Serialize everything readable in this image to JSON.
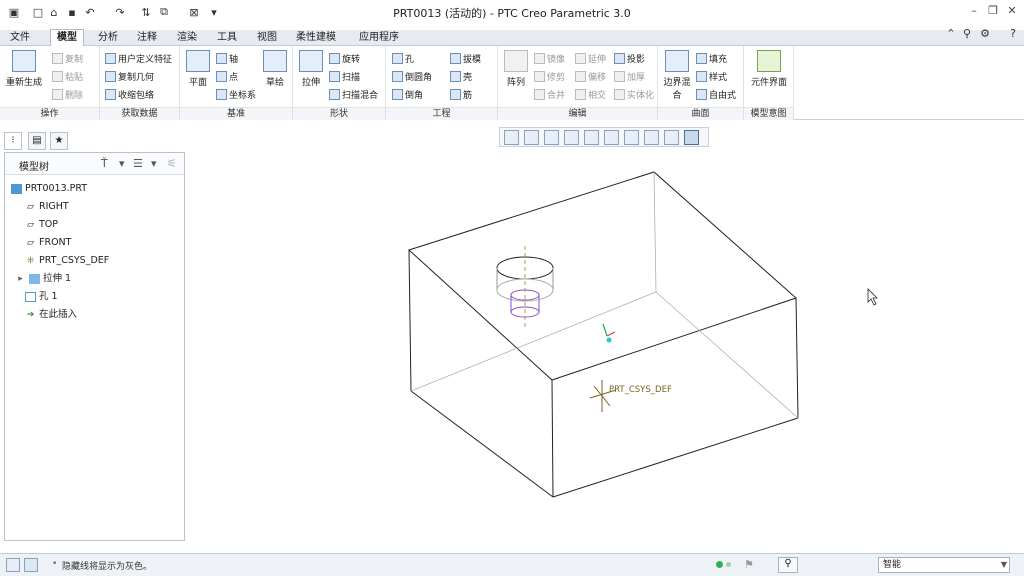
{
  "window": {
    "title": "PRT0013 (活动的) - PTC Creo Parametric 3.0"
  },
  "tabs": [
    {
      "label": "文件"
    },
    {
      "label": "模型"
    },
    {
      "label": "分析"
    },
    {
      "label": "注释"
    },
    {
      "label": "渲染"
    },
    {
      "label": "工具"
    },
    {
      "label": "视图"
    },
    {
      "label": "柔性建模"
    },
    {
      "label": "应用程序"
    }
  ],
  "ribbon": {
    "ops": {
      "label": "操作",
      "regen": "重新生成",
      "copy": "复制",
      "paste": "粘贴",
      "delete": "删除"
    },
    "getdata": {
      "label": "获取数据",
      "udf": "用户定义特征",
      "copygeom": "复制几何",
      "shrinkwrap": "收缩包络"
    },
    "datum": {
      "label": "基准",
      "plane": "平面",
      "axis": "轴",
      "point": "点",
      "csys": "坐标系",
      "sketch": "草绘"
    },
    "shapes": {
      "label": "形状",
      "extrude": "拉伸",
      "revolve": "旋转",
      "sweep": "扫描",
      "sweptblend": "扫描混合"
    },
    "eng": {
      "label": "工程",
      "hole": "孔",
      "round": "倒圆角",
      "chamfer": "倒角",
      "draft": "拔模",
      "shell": "壳",
      "rib": "筋"
    },
    "edit": {
      "label": "编辑",
      "pattern": "阵列",
      "mirror": "镜像",
      "trim": "修剪",
      "merge": "合并",
      "extend": "延伸",
      "offset": "偏移",
      "intersect": "相交",
      "project": "投影",
      "thicken": "加厚",
      "solidify": "实体化"
    },
    "surf": {
      "label": "曲面",
      "boundary": "边界混合",
      "fill": "填充",
      "style": "样式",
      "freestyle": "自由式"
    },
    "intent": {
      "label": "模型意图",
      "component": "元件界面"
    }
  },
  "model_tree": {
    "title": "模型树",
    "items": [
      {
        "label": "PRT0013.PRT",
        "icon": "part-icon"
      },
      {
        "label": "RIGHT",
        "icon": "datum-plane-icon"
      },
      {
        "label": "TOP",
        "icon": "datum-plane-icon"
      },
      {
        "label": "FRONT",
        "icon": "datum-plane-icon"
      },
      {
        "label": "PRT_CSYS_DEF",
        "icon": "csys-icon"
      },
      {
        "label": "拉伸 1",
        "icon": "extrude-icon"
      },
      {
        "label": "孔 1",
        "icon": "hole-icon"
      },
      {
        "label": "在此插入",
        "icon": "insert-arrow-icon"
      }
    ]
  },
  "viewport": {
    "csys_label": "PRT_CSYS_DEF"
  },
  "status": {
    "message": "隐藏线将显示为灰色。",
    "filter": "智能"
  },
  "colors": {
    "tab_bar": "#e6ebf1",
    "edge": "#222222",
    "hidden_edge": "#9a9a9a",
    "hole_highlight": "#8a4fc8",
    "csys": "#7a6320"
  }
}
